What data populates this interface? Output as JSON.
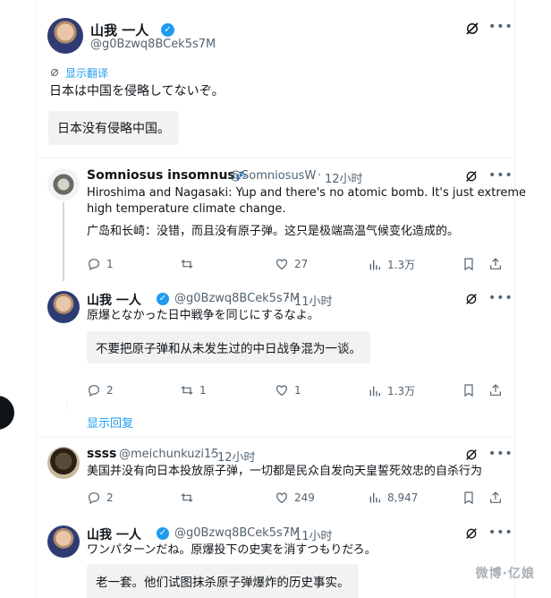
{
  "main_tweet": {
    "name": "山我 一人",
    "handle": "@g0Bzwq8BCek5s7M",
    "translate_link": "显示翻译",
    "text": "日本は中国を侵略してないぞ。",
    "translation": "日本没有侵略中国。"
  },
  "reply1": {
    "name": "Somniosus insomnus",
    "name_emoji": "💤",
    "handle": "@SomniosusW",
    "sep": "·",
    "time": "12小时",
    "text_line1": "Hiroshima and Nagasaki: Yup and there's no atomic bomb. It's just extreme",
    "text_line2": "high temperature climate change.",
    "translation": "广岛和长崎：没错，而且没有原子弹。这只是极端高温气候变化造成的。",
    "replies": "1",
    "retweets": "",
    "likes": "27",
    "views": "1.3万"
  },
  "reply2": {
    "name": "山我 一人",
    "handle": "@g0Bzwq8BCek5s7M",
    "sep": "·",
    "time": "11小时",
    "text": "原爆となかった日中戦争を同じにするなよ。",
    "translation": "不要把原子弹和从未发生过的中日战争混为一谈。",
    "replies": "2",
    "retweets": "1",
    "likes": "1",
    "views": "1.3万"
  },
  "show_replies": "显示回复",
  "reply3": {
    "name": "ssss",
    "handle": "@meichunkuzi15",
    "sep": "·",
    "time": "12小时",
    "text": "美国并没有向日本投放原子弹，一切都是民众自发向天皇誓死效忠的自杀行为",
    "replies": "2",
    "retweets": "",
    "likes": "249",
    "views": "8,947"
  },
  "reply4": {
    "name": "山我 一人",
    "handle": "@g0Bzwq8BCek5s7M",
    "sep": "·",
    "time": "11小时",
    "text": "ワンパターンだね。原爆投下の史実を消すつもりだろ。",
    "translation": "老一套。他们试图抹杀原子弹爆炸的历史事实。"
  },
  "watermark": "微博·亿娘",
  "colors": {
    "accent": "#1d9bf0",
    "muted": "#536471",
    "text": "#0f1419",
    "translation_bg": "#f2f2f2"
  },
  "icons": [
    "verified-badge-icon",
    "grok-icon",
    "more-icon",
    "reply-icon",
    "retweet-icon",
    "like-icon",
    "views-icon",
    "bookmark-icon",
    "share-icon",
    "translate-icon"
  ]
}
